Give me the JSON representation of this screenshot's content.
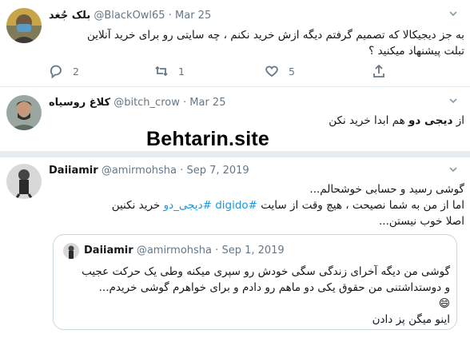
{
  "tweet1": {
    "name": "بلک جُغد",
    "handle": "@BlackOwl65",
    "date": "Mar 25",
    "text_line1": "به جز دیجیکالا که تصمیم گرفتم دیگه ازش خرید نکنم ، چه سایتی رو برای خرید آنلاین",
    "text_line2": "تبلت پیشنهاد میکنید ؟",
    "replies": "2",
    "retweets": "1",
    "likes": "5"
  },
  "tweet2": {
    "name": "کلاغ روسیاه",
    "handle": "@bitch_crow",
    "date": "Mar 25",
    "text_pre": "از ",
    "text_bold": "دیجی دو",
    "text_post": " هم ابدا خرید نکن"
  },
  "watermark": "Behtarin.site",
  "tweet3": {
    "name": "Daiiamir",
    "handle": "@amirmohsha",
    "date": "Sep 7, 2019",
    "line1": "گوشی رسید و حسابی خوشحالم...",
    "line2_a": "اما از من به شما نصیحت ، هیچ وقت از سایت ",
    "line2_link1": "#digido",
    "line2_link2": "#دیجی_دو",
    "line2_b": " خرید نکنین",
    "line3": "اصلا خوب نیستن...",
    "quote": {
      "name": "Daiiamir",
      "handle": "@amirmohsha",
      "date": "Sep 1, 2019",
      "line1": "گوشی من دیگه آخرای زندگی سگی خودش رو سپری میکنه وطی یک حرکت عجیب",
      "line2": "و دوستداشتنی من حقوق یکی دو ماهم رو دادم و برای خواهرم گوشی خریدم...",
      "emoji": "😄",
      "line3": "اینو میگن پز دادن"
    }
  },
  "colors": {
    "link": "#1b95e0",
    "secondary_text": "#657786",
    "border": "#ccd6dd"
  }
}
